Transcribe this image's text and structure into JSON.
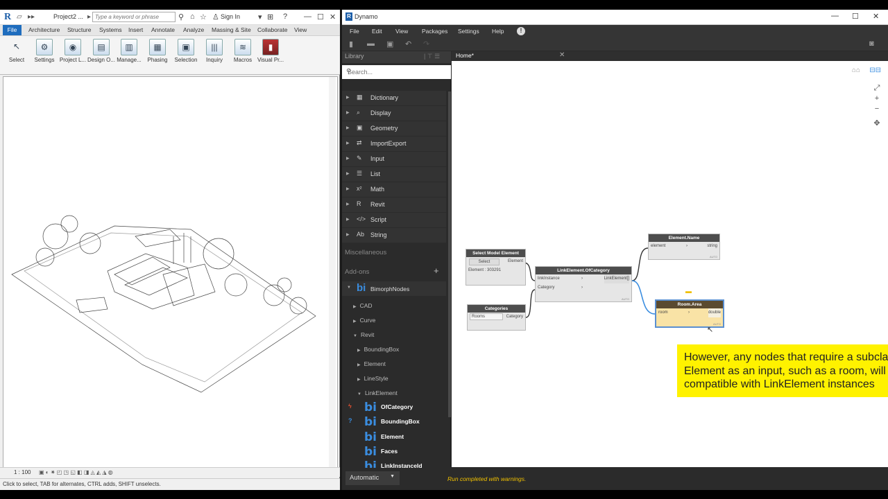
{
  "revit": {
    "logo": "R",
    "project": "Project2 ...",
    "search_placeholder": "Type a keyword or phrase",
    "sign_in": "Sign In",
    "tabs": [
      "File",
      "Architecture",
      "Structure",
      "Systems",
      "Insert",
      "Annotate",
      "Analyze",
      "Massing & Site",
      "Collaborate",
      "View"
    ],
    "ribbon": [
      "Select",
      "Settings",
      "Project L...",
      "Design O...",
      "Manage...",
      "Phasing",
      "Selection",
      "Inquiry",
      "Macros",
      "Visual Pr..."
    ],
    "scale": "1 : 100",
    "status": "Click to select, TAB for alternates, CTRL adds, SHIFT unselects."
  },
  "dynamo": {
    "logo": "R",
    "title": "Dynamo",
    "menu": [
      "File",
      "Edit",
      "View",
      "Packages",
      "Settings",
      "Help"
    ],
    "library_label": "Library",
    "search_placeholder": "Search...",
    "categories": [
      {
        "label": "Dictionary",
        "icon": "▦"
      },
      {
        "label": "Display",
        "icon": "⌕"
      },
      {
        "label": "Geometry",
        "icon": "▣"
      },
      {
        "label": "ImportExport",
        "icon": "⇄"
      },
      {
        "label": "Input",
        "icon": "✎"
      },
      {
        "label": "List",
        "icon": "☰"
      },
      {
        "label": "Math",
        "icon": "x²"
      },
      {
        "label": "Revit",
        "icon": "R"
      },
      {
        "label": "Script",
        "icon": "</>"
      },
      {
        "label": "String",
        "icon": "Ab"
      }
    ],
    "misc_label": "Miscellaneous",
    "addons_label": "Add-ons",
    "bimorph": "BimorphNodes",
    "tree": [
      "CAD",
      "Curve",
      "Revit",
      "BoundingBox",
      "Element",
      "LineStyle",
      "LinkElement"
    ],
    "leaves": [
      "OfCategory",
      "BoundingBox",
      "Element",
      "Faces",
      "LinkInstanceId"
    ],
    "workspace_tab": "Home*",
    "nodes": {
      "select_model": {
        "title": "Select Model Element",
        "button": "Select",
        "out": "Element",
        "value": "Element : 303291"
      },
      "categories": {
        "title": "Categories",
        "value": "Rooms",
        "out": "Category"
      },
      "link_cat": {
        "title": "LinkElement.OfCategory",
        "in1": "linkInstance",
        "in2": "Category",
        "out": "LinkElement[]"
      },
      "elem_name": {
        "title": "Element.Name",
        "in": "element",
        "out": "string"
      },
      "room_area": {
        "title": "Room.Area",
        "in": "room",
        "out": "double"
      },
      "foot": "AUTO"
    },
    "caption": "However, any nodes that require a subclass of Element as an input, such as a room, will not be compatible with LinkElement instances",
    "run_mode": "Automatic",
    "status": "Run completed with warnings."
  }
}
